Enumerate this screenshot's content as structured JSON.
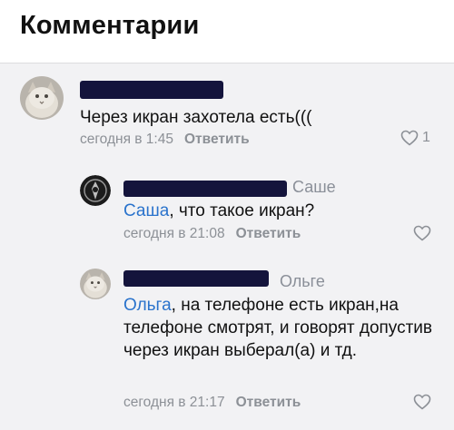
{
  "header": {
    "title": "Комментарии"
  },
  "comments": [
    {
      "text": "Через икран захотела есть(((",
      "time": "сегодня в 1:45",
      "reply_label": "Ответить",
      "likes": "1",
      "avatar_icon": "cat-avatar"
    },
    {
      "reply_to": "Саше",
      "mention": "Саша",
      "text": ", что такое икран?",
      "time": "сегодня в 21:08",
      "reply_label": "Ответить",
      "avatar_icon": "dark-emblem-avatar"
    },
    {
      "reply_to": "Ольге",
      "mention": "Ольга",
      "text": ", на телефоне есть икран,на телефоне смотрят, и говорят допустив через икран выберал(а) и тд.",
      "time": "сегодня в 21:17",
      "reply_label": "Ответить",
      "avatar_icon": "cat-avatar"
    }
  ],
  "colors": {
    "background": "#f2f2f4",
    "mention": "#2a73cc",
    "meta": "#8c9096",
    "redaction": "#14143c"
  }
}
